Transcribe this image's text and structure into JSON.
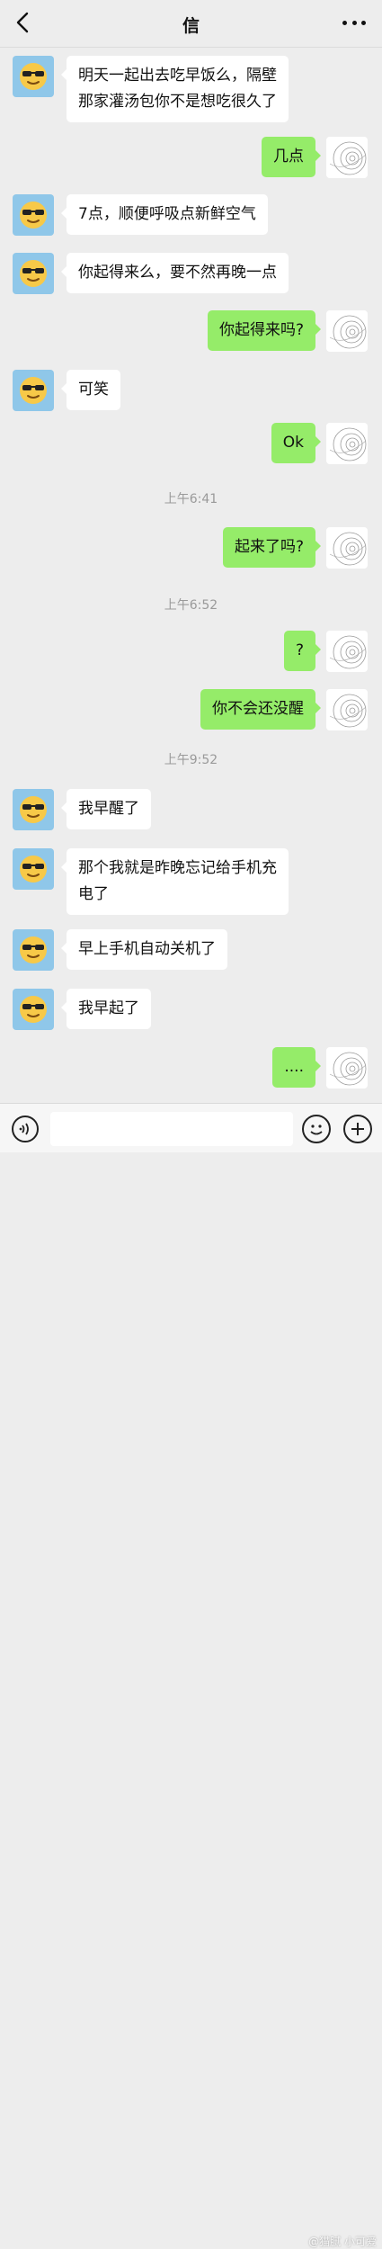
{
  "header": {
    "back_icon": "chevron-left-icon",
    "title": "信",
    "more_icon": "more-dots-icon"
  },
  "messages": [
    {
      "side": "in",
      "lines": [
        "明天一起出去吃早饭么，隔壁",
        "那家灌汤包你不是想吃很久了"
      ]
    },
    {
      "side": "out",
      "text": "几点"
    },
    {
      "side": "in",
      "text": "7点，顺便呼吸点新鲜空气"
    },
    {
      "side": "in",
      "text": "你起得来么，要不然再晚一点"
    },
    {
      "side": "out",
      "text": "你起得来吗?"
    },
    {
      "side": "in",
      "text": "可笑"
    },
    {
      "side": "out",
      "text": "Ok"
    },
    {
      "type": "timestamp",
      "text": "上午6:41"
    },
    {
      "side": "out",
      "text": "起来了吗?"
    },
    {
      "type": "timestamp",
      "text": "上午6:52"
    },
    {
      "side": "out",
      "text": "?"
    },
    {
      "side": "out",
      "text": "你不会还没醒"
    },
    {
      "type": "timestamp",
      "text": "上午9:52"
    },
    {
      "side": "in",
      "text": "我早醒了"
    },
    {
      "side": "in",
      "lines": [
        "那个我就是昨晚忘记给手机充",
        "电了"
      ]
    },
    {
      "side": "in",
      "text": "早上手机自动关机了"
    },
    {
      "side": "in",
      "text": "我早起了"
    },
    {
      "side": "out",
      "text": "...."
    }
  ],
  "avatars": {
    "contact": "sunglasses-emoji-icon",
    "self": "spiral-sketch-icon"
  },
  "bottombar": {
    "voice_icon": "voice-icon",
    "emoji_icon": "emoji-face-icon",
    "plus_icon": "plus-icon"
  },
  "watermark": "@猫腻 小可爱",
  "colors": {
    "background": "#ededed",
    "incoming_bubble": "#ffffff",
    "outgoing_bubble": "#95ec69",
    "contact_avatar_bg": "#8fc7e9",
    "timestamp": "#9a9a9a"
  }
}
